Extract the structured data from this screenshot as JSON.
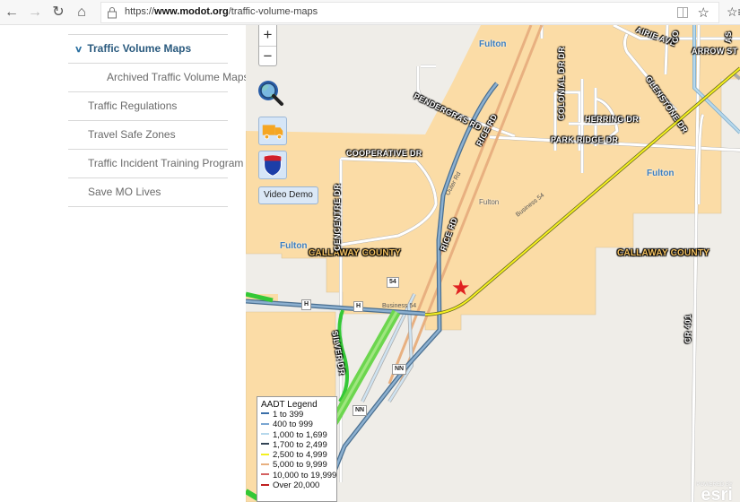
{
  "browser": {
    "url_prefix": "https://",
    "url_domain": "www.modot.org",
    "url_path": "/traffic-volume-maps",
    "back_icon": "←",
    "forward_icon": "→",
    "refresh_icon": "↻",
    "home_icon": "⌂",
    "favorite_icon": "☆",
    "favorites_bar_icon": "☆≡"
  },
  "sidebar": {
    "items": [
      {
        "label": "Traffic Volume Maps",
        "active": true,
        "chevron": "∨"
      },
      {
        "label": "Archived Traffic Volume Maps",
        "sub": true
      },
      {
        "label": "Traffic Regulations"
      },
      {
        "label": "Travel Safe Zones"
      },
      {
        "label": "Traffic Incident Training Program"
      },
      {
        "label": "Save MO Lives"
      }
    ]
  },
  "map": {
    "zoom_in": "+",
    "zoom_out": "−",
    "video_demo_label": "Video Demo",
    "labels": {
      "cooperative_dr": "COOPERATIVE DR",
      "pendergras_rd": "PENDERGRAS RD",
      "rice_rd_1": "RICE RD",
      "rice_rd_2": "RICE RD",
      "colonial_dr": "COLONIAL DR DR",
      "herring_dr": "HERRING DR",
      "park_ridge_dr": "PARK RIDGE DR",
      "glenstone_dr": "GLENSTONE DR",
      "arrow_st": "ARROW ST",
      "prairie_ave": "AIRIE AVE",
      "centre_dr": "CENCENTRE DR",
      "silver_dr": "SILVER DR",
      "cr_401": "CR 401",
      "co": "CO",
      "as": "AS"
    },
    "cities": {
      "fulton_top": "Fulton",
      "fulton_right": "Fulton",
      "fulton_left": "Fulton",
      "fulton_small": "Fulton"
    },
    "counties": {
      "left": "CALLAWAY COUNTY",
      "right": "CALLAWAY COUNTY"
    },
    "shields": {
      "h1": "H",
      "h2": "H",
      "us54": "54",
      "nn1": "NN",
      "nn2": "NN"
    },
    "road_small": {
      "business54": "Business 54",
      "business54_diag": "Business 54",
      "outer_rd": "Outer Rd"
    },
    "legend": {
      "title": "AADT Legend",
      "rows": [
        {
          "label": "1 to 399",
          "color": "#3a6fa8"
        },
        {
          "label": "400 to 999",
          "color": "#7aa6d2"
        },
        {
          "label": "1,000 to 1,699",
          "color": "#b6d8ec"
        },
        {
          "label": "1,700 to 2,499",
          "color": "#334455"
        },
        {
          "label": "2,500 to 4,999",
          "color": "#f4f020"
        },
        {
          "label": "5,000 to 9,999",
          "color": "#e8b080"
        },
        {
          "label": "10,000 to 19,999",
          "color": "#d46060"
        },
        {
          "label": "Over 20,000",
          "color": "#c02020"
        }
      ]
    },
    "esri_powered": "POWERED BY",
    "esri_logo": "esri",
    "marker_icon": "★"
  }
}
